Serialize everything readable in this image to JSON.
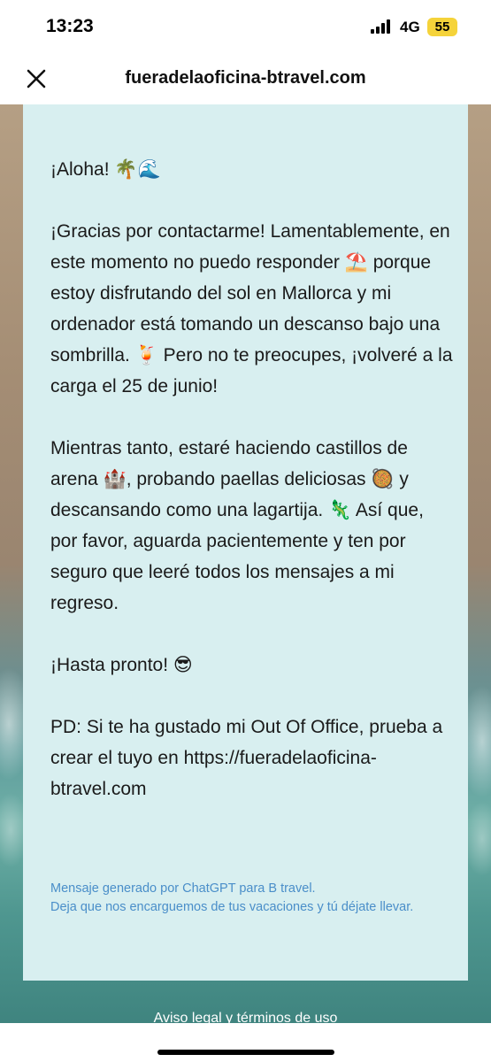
{
  "status_bar": {
    "time": "13:23",
    "network": "4G",
    "battery": "55",
    "signal_icon": "cellular-signal-icon"
  },
  "browser": {
    "close_icon": "close-icon",
    "url": "fueradelaoficina-btravel.com"
  },
  "message": {
    "greeting": "¡Aloha! 🌴🌊",
    "paragraph1": "¡Gracias por contactarme! Lamentablemente, en este momento no puedo responder ⛱️ porque estoy disfrutando del sol en Mallorca y mi ordenador está tomando un descanso bajo una sombrilla. 🍹 Pero no te preocupes, ¡volveré a la carga el 25 de junio!",
    "paragraph2": "Mientras tanto, estaré haciendo castillos de arena 🏰, probando paellas deliciosas 🥘 y descansando como una lagartija. 🦎 Así que, por favor, aguarda pacientemente y ten por seguro que leeré todos los mensajes a mi regreso.",
    "signoff": "¡Hasta pronto! 😎",
    "postscript": "PD: Si te ha gustado mi Out Of Office, prueba a crear el tuyo en https://fueradelaoficina-btravel.com"
  },
  "footer_note": {
    "line1": "Mensaje generado por ChatGPT para B travel.",
    "line2": "Deja que nos encarguemos de tus vacaciones y tú déjate llevar."
  },
  "legal_link": "Aviso legal y términos de uso",
  "colors": {
    "card_background": "#d8eff0",
    "footer_note_text": "#4a8ec9",
    "battery_badge": "#f5d33a"
  }
}
